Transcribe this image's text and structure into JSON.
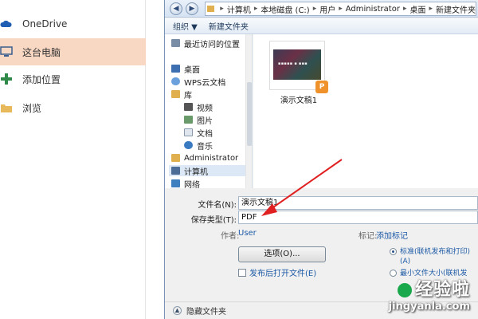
{
  "colors": {
    "selected_place": "#f8d7c3",
    "accent_arrow": "#e02020",
    "link": "#1d5aa6"
  },
  "left_panel": {
    "places": [
      {
        "label": "OneDrive",
        "icon": "cloud-icon"
      },
      {
        "label": "这台电脑",
        "icon": "computer-icon",
        "selected": true
      },
      {
        "label": "添加位置",
        "icon": "plus-icon"
      },
      {
        "label": "浏览",
        "icon": "folder-icon"
      }
    ]
  },
  "dialog": {
    "breadcrumb": [
      "计算机",
      "本地磁盘 (C:)",
      "用户",
      "Administrator",
      "桌面",
      "新建文件夹"
    ],
    "toolbar": {
      "organize": "组织 ▼",
      "new_folder": "新建文件夹"
    },
    "nav_items": [
      {
        "label": "最近访问的位置",
        "icon": "recent-icon"
      },
      {
        "label": "桌面",
        "icon": "desktop-icon"
      },
      {
        "label": "WPS云文档",
        "icon": "cloud-doc-icon"
      },
      {
        "label": "库",
        "icon": "library-icon"
      },
      {
        "label": "视频",
        "icon": "video-icon"
      },
      {
        "label": "图片",
        "icon": "picture-icon"
      },
      {
        "label": "文档",
        "icon": "document-icon"
      },
      {
        "label": "音乐",
        "icon": "music-icon"
      },
      {
        "label": "Administrator",
        "icon": "user-icon"
      },
      {
        "label": "计算机",
        "icon": "computer-icon",
        "selected": true
      },
      {
        "label": "网络",
        "icon": "network-icon"
      }
    ],
    "file": {
      "name": "演示文稿1"
    },
    "form": {
      "filename_label": "文件名(N):",
      "filename_value": "演示文稿1",
      "filetype_label": "保存类型(T):",
      "filetype_value": "PDF",
      "author_label": "作者:",
      "author_value": "User",
      "tags_label": "标记:",
      "tags_value": "添加标记",
      "options_button": "选项(O)...",
      "open_after_label": "发布后打开文件(E)",
      "radio_standard": "标准(联机发布和打印)",
      "radio_standard_key": "(A)",
      "radio_min": "最小文件大小(联机发"
    },
    "status": {
      "hide_folders": "隐藏文件夹"
    }
  },
  "watermark": {
    "line1": "经验啦",
    "line2": "jingyanla.com"
  }
}
